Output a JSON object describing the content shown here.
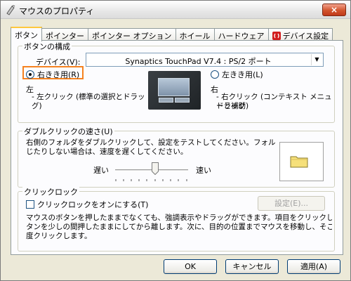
{
  "window": {
    "title": "マウスのプロパティ",
    "close_label": "×"
  },
  "tabs": [
    {
      "label": "ボタン"
    },
    {
      "label": "ポインター"
    },
    {
      "label": "ポインター オプション"
    },
    {
      "label": "ホイール"
    },
    {
      "label": "ハードウェア"
    },
    {
      "label": "デバイス設定"
    }
  ],
  "button_config": {
    "group_title": "ボタンの構成",
    "device_label": "デバイス(V):",
    "device_value": "Synaptics TouchPad V7.4 : PS/2 ポート",
    "right_handed_label": "右きき用(R)",
    "left_handed_label": "左きき用(L)",
    "left_heading": "左",
    "left_desc_1": "- 左クリック (標準の選択とドラッグ)",
    "right_heading": "右",
    "right_desc_1": "- 右クリック (コンテキスト メニューと補助",
    "right_desc_2": "ドラッグ)"
  },
  "double_click": {
    "group_title": "ダブルクリックの速さ(U)",
    "desc_1": "右側のフォルダをダブルクリックして、設定をテストしてください。フォルダが開いたり閉",
    "desc_2": "じたりしない場合は、速度を遅くしてください。",
    "slow_label": "遅い",
    "fast_label": "速い",
    "speed_fraction": 0.55
  },
  "click_lock": {
    "group_title": "クリックロック",
    "checkbox_label": "クリックロックをオンにする(T)",
    "settings_button": "設定(E)...",
    "desc_1": "マウスのボタンを押したままでなくても、強調表示やドラッグができます。項目をクリックし、マウスのボ",
    "desc_2": "タンを少しの間押したままにしてから離します。次に、目的の位置までマウスを移動し、そこでもう一",
    "desc_3": "度クリックします。"
  },
  "footer": {
    "ok": "OK",
    "cancel": "キャンセル",
    "apply": "適用(A)"
  },
  "colors": {
    "highlight": "#f58220"
  },
  "icons": {
    "title": "mouse-icon",
    "device_tab": "synaptics-icon",
    "folder": "folder-icon",
    "dropdown": "chevron-down-icon"
  }
}
